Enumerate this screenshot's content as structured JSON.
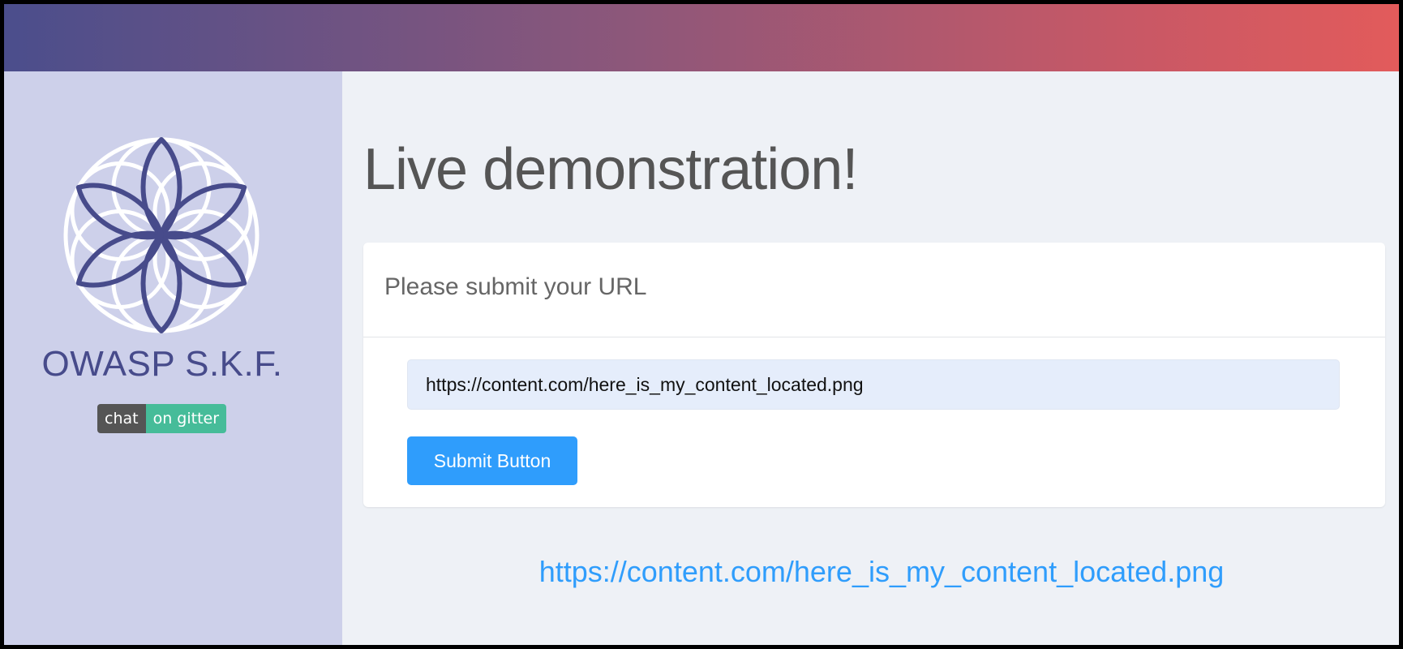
{
  "sidebar": {
    "brand": "OWASP S.K.F.",
    "badge_left": "chat",
    "badge_right": "on gitter",
    "logo_icon": "flower-of-life-logo-icon"
  },
  "main": {
    "title": "Live demonstration!",
    "card_header": "Please submit your URL",
    "url_value": "https://content.com/here_is_my_content_located.png",
    "submit_label": "Submit Button",
    "result_link": "https://content.com/here_is_my_content_located.png"
  },
  "colors": {
    "gradient_start": "#4b4e8c",
    "gradient_end": "#e25b5b",
    "sidebar_bg": "#cdd0ea",
    "brand_color": "#474b8b",
    "accent": "#2f9dfc",
    "badge_left_bg": "#555555",
    "badge_right_bg": "#46bc99"
  }
}
